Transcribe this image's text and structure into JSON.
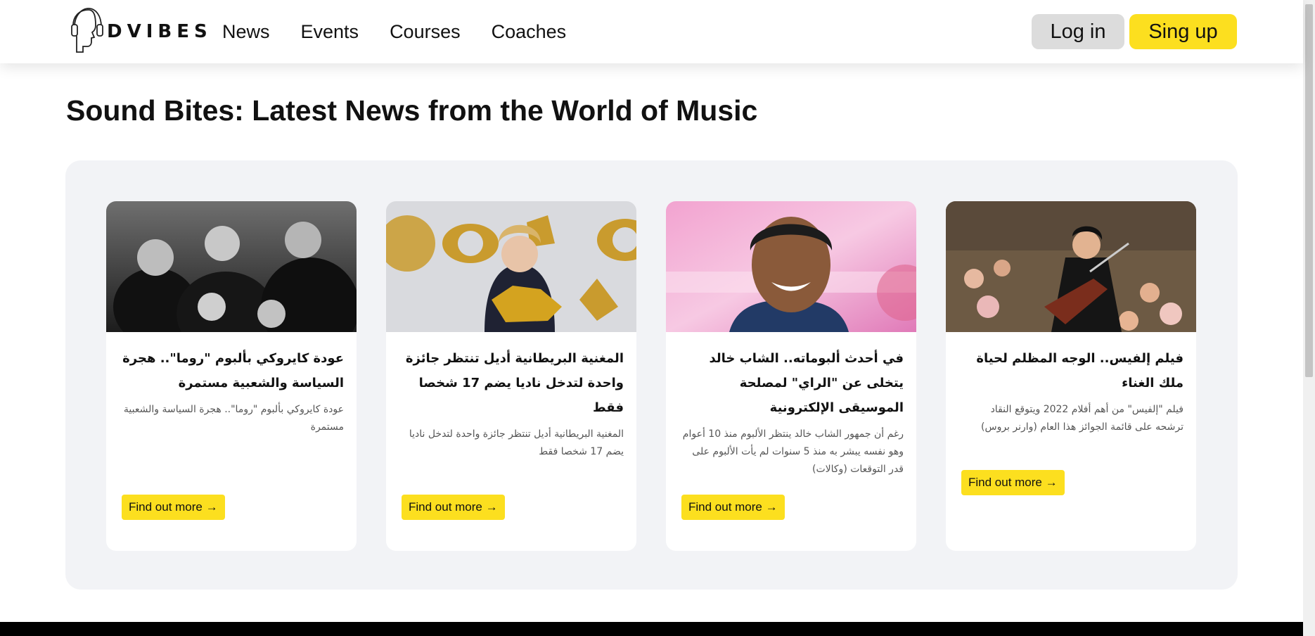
{
  "brand": {
    "name": "DVIBES"
  },
  "nav": [
    "News",
    "Events",
    "Courses",
    "Coaches"
  ],
  "auth": {
    "login": "Log in",
    "signup": "Sing up"
  },
  "page": {
    "title": "Sound Bites: Latest News from the World of Music"
  },
  "cards": [
    {
      "image": "band-photo-grayscale",
      "title": "عودة كايروكي بألبوم \"روما\".. هجرة السياسة والشعبية مستمرة",
      "desc": "عودة كايروكي بألبوم \"روما\".. هجرة السياسة والشعبية مستمرة",
      "button": "Find out more →"
    },
    {
      "image": "singer-with-awards-photo",
      "title": "المغنية البريطانية أديل تنتظر جائزة واحدة لتدخل ناديا يضم 17 شخصا فقط",
      "desc": "المغنية البريطانية أديل تنتظر جائزة واحدة لتدخل ناديا يضم 17 شخصا فقط",
      "button": "Find out more →"
    },
    {
      "image": "smiling-singer-photo",
      "title": "في أحدث ألبوماته.. الشاب خالد يتخلى عن \"الراي\" لمصلحة الموسيقى الإلكترونية",
      "desc": "رغم أن جمهور الشاب خالد ينتظر الألبوم منذ 10 أعوام وهو نفسه يبشر به منذ 5 سنوات لم يأت الألبوم على قدر التوقعات (وكالات)",
      "button": "Find out more →"
    },
    {
      "image": "guitar-performer-photo",
      "title": "فيلم إلفيس.. الوجه المظلم لحياة ملك الغناء",
      "desc": "فيلم \"إلفيس\" من أهم أفلام 2022 ويتوقع النقاد ترشحه على قائمة الجوائز هذا العام (وارنر بروس)",
      "button": "Find out more →"
    }
  ],
  "colors": {
    "accent": "#fcdf1f",
    "panel": "#f2f3f6",
    "login_bg": "#dcdcdc"
  }
}
